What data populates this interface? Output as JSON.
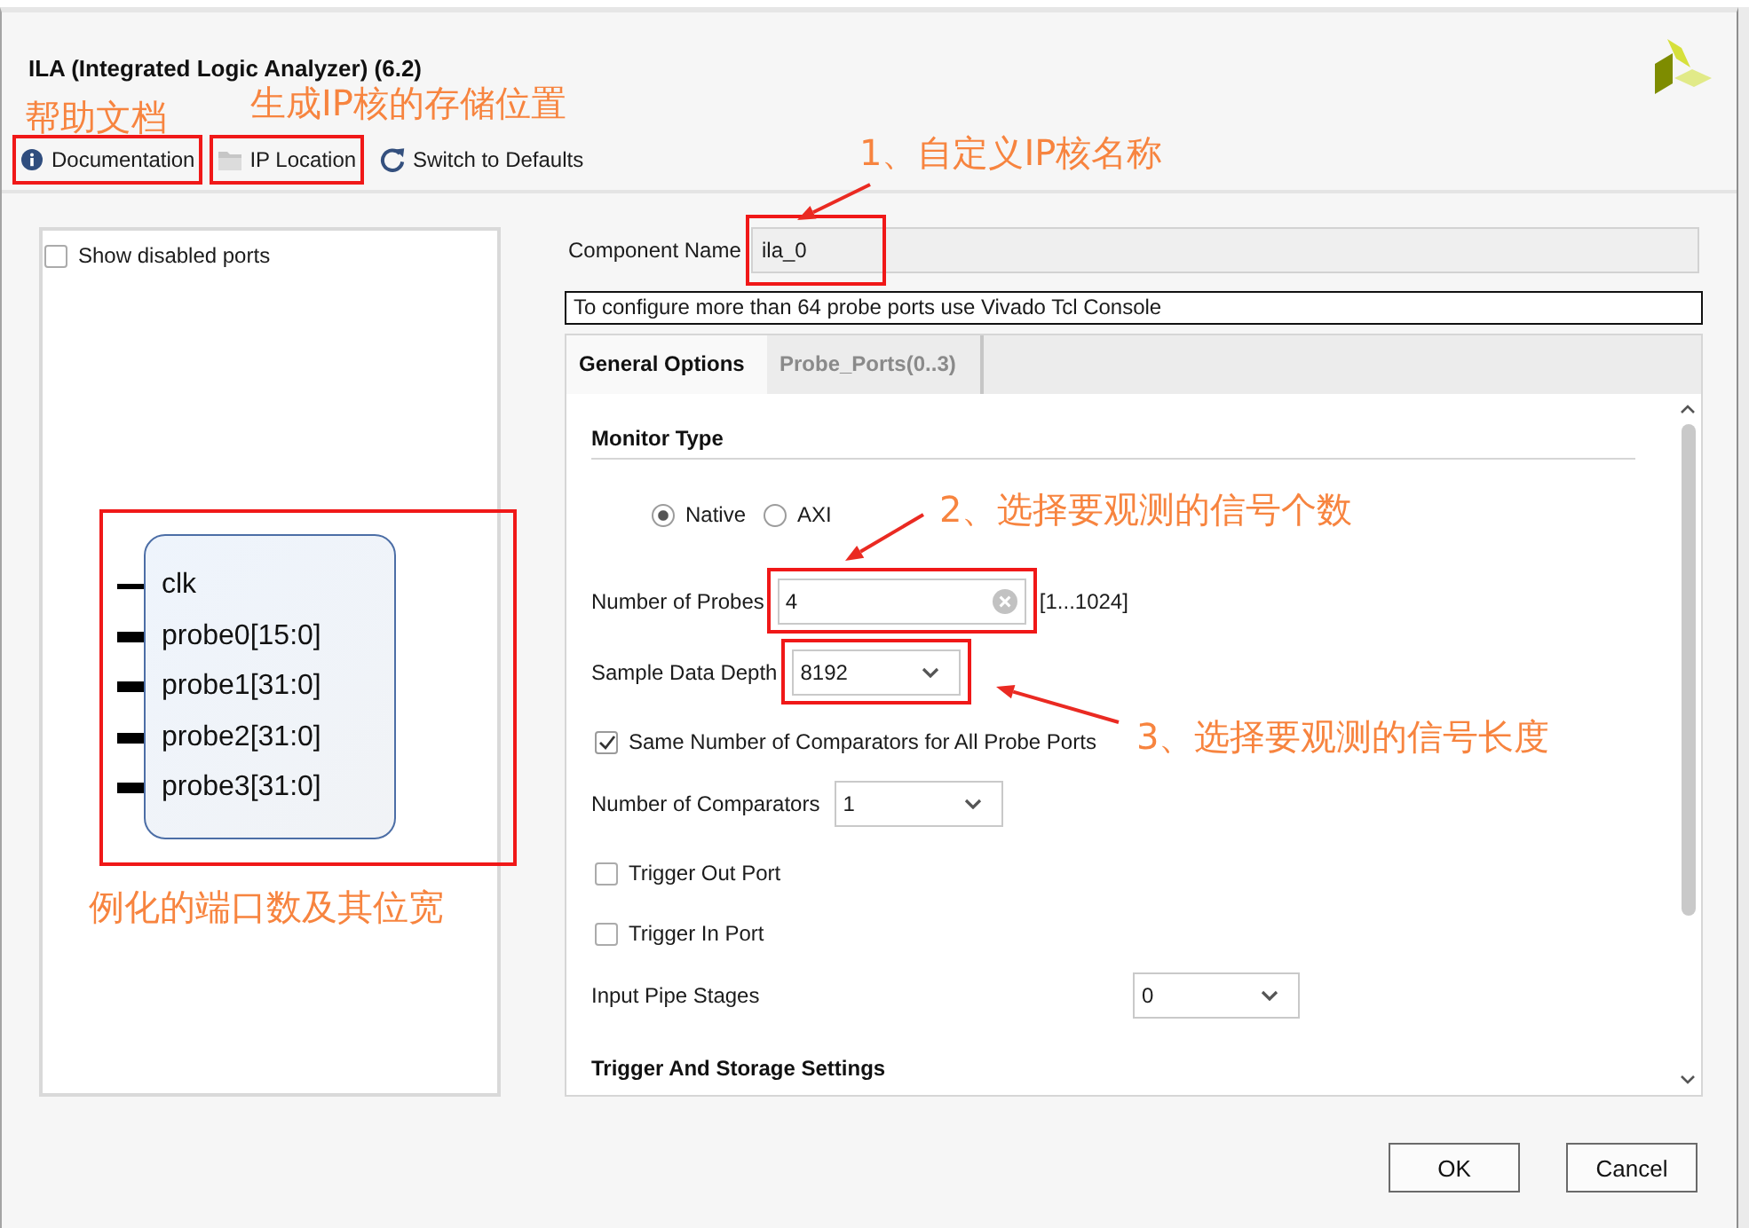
{
  "window": {
    "title": "ILA (Integrated Logic Analyzer) (6.2)"
  },
  "toolbar": [
    {
      "kind": "info",
      "label": "Documentation",
      "highlighted": true
    },
    {
      "kind": "folder",
      "label": "IP Location",
      "highlighted": true
    },
    {
      "kind": "refresh",
      "label": "Switch to Defaults",
      "highlighted": false
    }
  ],
  "ports_panel": {
    "show_disabled_ports": {
      "label": "Show disabled ports",
      "checked": false
    },
    "block": {
      "highlighted": true,
      "ports": [
        {
          "kind": "single",
          "label": "clk"
        },
        {
          "kind": "bus",
          "label": "probe0[15:0]"
        },
        {
          "kind": "bus",
          "label": "probe1[31:0]"
        },
        {
          "kind": "bus",
          "label": "probe2[31:0]"
        },
        {
          "kind": "bus",
          "label": "probe3[31:0]"
        }
      ]
    }
  },
  "component_name": {
    "label": "Component Name",
    "value": "ila_0",
    "highlighted": true
  },
  "info_note": "To configure more than 64 probe ports use Vivado Tcl Console",
  "tabs": [
    {
      "label": "General Options",
      "selected": true
    },
    {
      "label": "Probe_Ports(0..3)",
      "selected": false
    }
  ],
  "general_options": {
    "monitor_type": {
      "heading": "Monitor Type",
      "options": [
        {
          "label": "Native",
          "selected": true
        },
        {
          "label": "AXI",
          "selected": false
        }
      ]
    },
    "settings": [
      {
        "kind": "number",
        "label": "Number of Probes",
        "value": "4",
        "range": "[1...1024]",
        "highlighted": true
      },
      {
        "kind": "dropdown",
        "label": "Sample Data Depth",
        "value": "8192",
        "highlighted": true
      },
      {
        "kind": "checkbox",
        "label": "Same Number of Comparators for All Probe Ports",
        "checked": true,
        "highlighted": false
      },
      {
        "kind": "dropdown",
        "label": "Number of Comparators",
        "value": "1",
        "highlighted": false
      },
      {
        "kind": "checkbox",
        "label": "Trigger Out Port",
        "checked": false,
        "highlighted": false
      },
      {
        "kind": "checkbox",
        "label": "Trigger In Port",
        "checked": false,
        "highlighted": false
      }
    ],
    "input_pipe_stages": {
      "label": "Input Pipe Stages",
      "value": "0"
    },
    "next_heading": "Trigger And Storage Settings"
  },
  "buttons": [
    {
      "label": "OK"
    },
    {
      "label": "Cancel"
    }
  ],
  "callouts": [
    {
      "text": "帮助文档",
      "arrow": false
    },
    {
      "text": "生成IP核的存储位置",
      "arrow": false
    },
    {
      "text": "1、自定义IP核名称",
      "arrow": true
    },
    {
      "text": "2、选择要观测的信号个数",
      "arrow": true
    },
    {
      "text": "3、选择要观测的信号长度",
      "arrow": true
    },
    {
      "text": "例化的端口数及其位宽",
      "arrow": false
    }
  ]
}
